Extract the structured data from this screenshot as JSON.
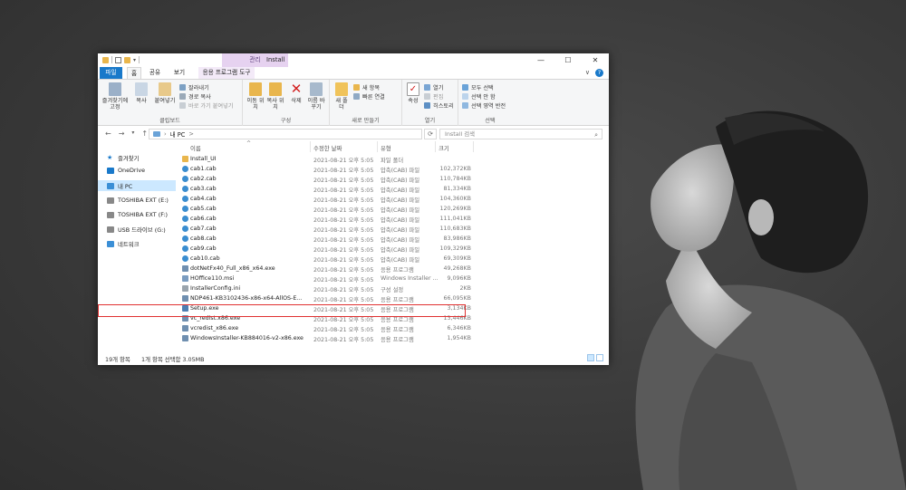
{
  "window": {
    "title": "Install",
    "context_tab_header": "관리",
    "controls": {
      "minimize": "—",
      "maximize": "☐",
      "close": "✕"
    }
  },
  "ribbon_tabs": {
    "file": "파일",
    "home": "홈",
    "share": "공유",
    "view": "보기",
    "app_tools": "응용 프로그램 도구",
    "collapse": "∨"
  },
  "ribbon": {
    "clipboard": {
      "label": "클립보드",
      "pin": "즐겨찾기에 고정",
      "copy": "복사",
      "paste": "붙여넣기",
      "cut": "잘라내기",
      "copy_path": "경로 복사",
      "paste_shortcut": "바로 가기 붙여넣기"
    },
    "organize": {
      "label": "구성",
      "move_to": "이동 위치",
      "copy_to": "복사 위치",
      "delete": "삭제",
      "rename": "이름 바꾸기"
    },
    "new": {
      "label": "새로 만들기",
      "new_folder": "새 폴더",
      "new_item": "새 항목",
      "easy_access": "빠른 연결"
    },
    "open": {
      "label": "열기",
      "properties": "속성",
      "open": "열기",
      "edit": "편집",
      "history": "히스토리"
    },
    "select": {
      "label": "선택",
      "select_all": "모두 선택",
      "select_none": "선택 안 함",
      "invert": "선택 영역 반전"
    }
  },
  "address": {
    "back": "←",
    "forward": "→",
    "up": "↑",
    "path": [
      "내 PC",
      ">"
    ],
    "refresh": "⟳",
    "search_placeholder": "Install 검색"
  },
  "nav_pane": [
    {
      "label": "즐겨찾기",
      "icon": "star-icon",
      "color": "#1979ca"
    },
    {
      "label": "OneDrive",
      "icon": "cloud-icon",
      "color": "#1979ca"
    },
    {
      "label": "내 PC",
      "icon": "pc-icon",
      "color": "#3b8fd6"
    },
    {
      "label": "TOSHIBA EXT (E:)",
      "icon": "drive-icon",
      "color": "#888888"
    },
    {
      "label": "TOSHIBA EXT (F:)",
      "icon": "drive-icon",
      "color": "#888888"
    },
    {
      "label": "USB 드라이브 (G:)",
      "icon": "usb-icon",
      "color": "#888888"
    },
    {
      "label": "네트워크",
      "icon": "network-icon",
      "color": "#3b8fd6"
    }
  ],
  "columns": {
    "name": "이름",
    "date": "수정한 날짜",
    "type": "유형",
    "size": "크기"
  },
  "files": [
    {
      "name": "Install_UI",
      "date": "2021-08-21 오후 5:05",
      "type": "파일 폴더",
      "size": "",
      "icon": "folder-icon"
    },
    {
      "name": "cab1.cab",
      "date": "2021-08-21 오후 5:05",
      "type": "압축(CAB) 파일",
      "size": "102,372KB",
      "icon": "cab-icon"
    },
    {
      "name": "cab2.cab",
      "date": "2021-08-21 오후 5:05",
      "type": "압축(CAB) 파일",
      "size": "110,784KB",
      "icon": "cab-icon"
    },
    {
      "name": "cab3.cab",
      "date": "2021-08-21 오후 5:05",
      "type": "압축(CAB) 파일",
      "size": "81,334KB",
      "icon": "cab-icon"
    },
    {
      "name": "cab4.cab",
      "date": "2021-08-21 오후 5:05",
      "type": "압축(CAB) 파일",
      "size": "104,360KB",
      "icon": "cab-icon"
    },
    {
      "name": "cab5.cab",
      "date": "2021-08-21 오후 5:05",
      "type": "압축(CAB) 파일",
      "size": "120,269KB",
      "icon": "cab-icon"
    },
    {
      "name": "cab6.cab",
      "date": "2021-08-21 오후 5:05",
      "type": "압축(CAB) 파일",
      "size": "111,041KB",
      "icon": "cab-icon"
    },
    {
      "name": "cab7.cab",
      "date": "2021-08-21 오후 5:05",
      "type": "압축(CAB) 파일",
      "size": "110,683KB",
      "icon": "cab-icon"
    },
    {
      "name": "cab8.cab",
      "date": "2021-08-21 오후 5:05",
      "type": "압축(CAB) 파일",
      "size": "83,986KB",
      "icon": "cab-icon"
    },
    {
      "name": "cab9.cab",
      "date": "2021-08-21 오후 5:05",
      "type": "압축(CAB) 파일",
      "size": "109,329KB",
      "icon": "cab-icon"
    },
    {
      "name": "cab10.cab",
      "date": "2021-08-21 오후 5:05",
      "type": "압축(CAB) 파일",
      "size": "69,309KB",
      "icon": "cab-icon"
    },
    {
      "name": "dotNetFx40_Full_x86_x64.exe",
      "date": "2021-08-21 오후 5:05",
      "type": "응용 프로그램",
      "size": "49,268KB",
      "icon": "exe-icon"
    },
    {
      "name": "HOffice110.msi",
      "date": "2021-08-21 오후 5:05",
      "type": "Windows Installer ...",
      "size": "9,096KB",
      "icon": "msi-icon"
    },
    {
      "name": "InstallerConfig.ini",
      "date": "2021-08-21 오후 5:05",
      "type": "구성 설정",
      "size": "2KB",
      "icon": "ini-icon"
    },
    {
      "name": "NDP461-KB3102436-x86-x64-AllOS-E...",
      "date": "2021-08-21 오후 5:05",
      "type": "응용 프로그램",
      "size": "66,095KB",
      "icon": "exe-icon"
    },
    {
      "name": "Setup.exe",
      "date": "2021-08-21 오후 5:05",
      "type": "응용 프로그램",
      "size": "3,134KB",
      "icon": "setup-icon"
    },
    {
      "name": "vc_redist.x86.exe",
      "date": "2021-08-21 오후 5:05",
      "type": "응용 프로그램",
      "size": "13,446KB",
      "icon": "exe-icon"
    },
    {
      "name": "vcredist_x86.exe",
      "date": "2021-08-21 오후 5:05",
      "type": "응용 프로그램",
      "size": "6,346KB",
      "icon": "exe-icon"
    },
    {
      "name": "WindowsInstaller-KB884016-v2-x86.exe",
      "date": "2021-08-21 오후 5:05",
      "type": "응용 프로그램",
      "size": "1,954KB",
      "icon": "exe-icon"
    }
  ],
  "selected_file": "Setup.exe",
  "status": {
    "count": "19개 항목",
    "selection": "1개 항목 선택함 3.05MB"
  },
  "colors": {
    "accent": "#1979ca",
    "selection": "#cce8ff",
    "highlight_box": "#e03131",
    "context_tab": "#e6d2f0"
  }
}
